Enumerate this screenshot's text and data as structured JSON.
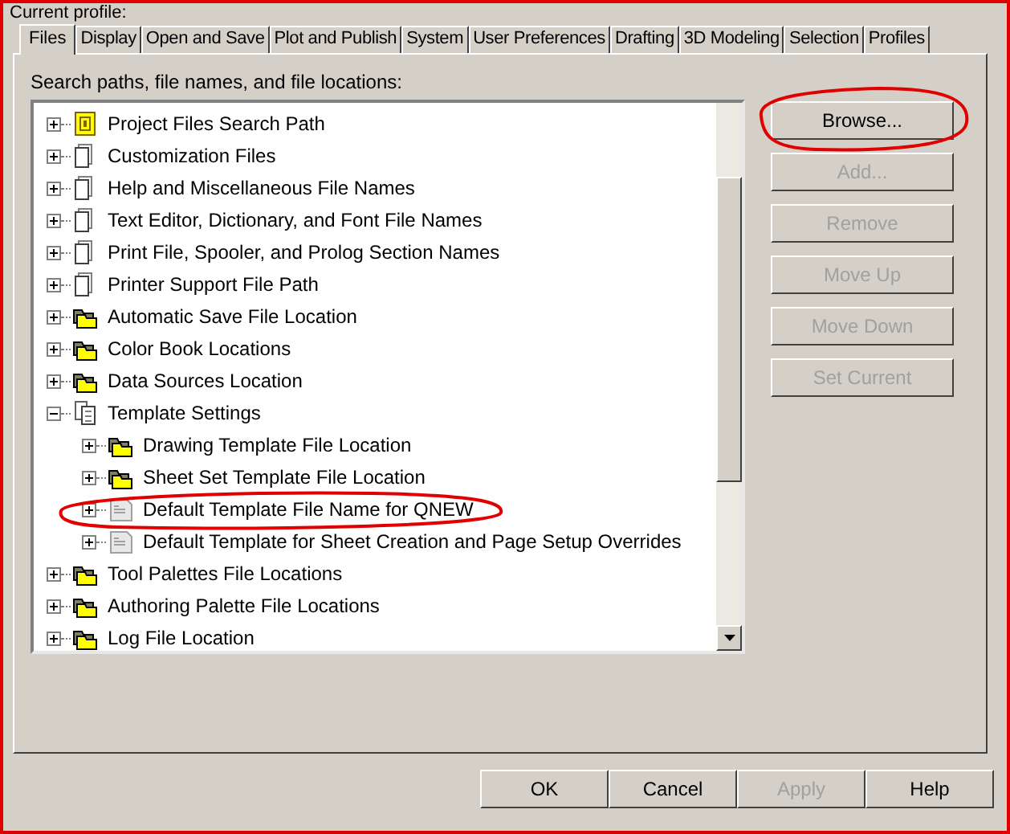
{
  "header": {
    "label": "Current profile:"
  },
  "tabs": [
    {
      "label": "Files",
      "selected": true
    },
    {
      "label": "Display",
      "selected": false
    },
    {
      "label": "Open and Save",
      "selected": false
    },
    {
      "label": "Plot and Publish",
      "selected": false
    },
    {
      "label": "System",
      "selected": false
    },
    {
      "label": "User Preferences",
      "selected": false
    },
    {
      "label": "Drafting",
      "selected": false
    },
    {
      "label": "3D Modeling",
      "selected": false
    },
    {
      "label": "Selection",
      "selected": false
    },
    {
      "label": "Profiles",
      "selected": false
    }
  ],
  "tree": {
    "caption": "Search paths, file names, and file locations:",
    "items": [
      {
        "label": "Project Files Search Path",
        "kind": "project",
        "expanded": false
      },
      {
        "label": "Customization Files",
        "kind": "file",
        "expanded": false
      },
      {
        "label": "Help and Miscellaneous File Names",
        "kind": "file",
        "expanded": false
      },
      {
        "label": "Text Editor, Dictionary, and Font File Names",
        "kind": "file",
        "expanded": false
      },
      {
        "label": "Print File, Spooler, and Prolog Section Names",
        "kind": "file",
        "expanded": false
      },
      {
        "label": "Printer Support File Path",
        "kind": "file",
        "expanded": false
      },
      {
        "label": "Automatic Save File Location",
        "kind": "folder",
        "expanded": false
      },
      {
        "label": "Color Book Locations",
        "kind": "folder",
        "expanded": false
      },
      {
        "label": "Data Sources Location",
        "kind": "folder",
        "expanded": false
      },
      {
        "label": "Template Settings",
        "kind": "pages",
        "expanded": true,
        "children": [
          {
            "label": "Drawing Template File Location",
            "kind": "folder",
            "expanded": false
          },
          {
            "label": "Sheet Set Template File Location",
            "kind": "folder",
            "expanded": false
          },
          {
            "label": "Default Template File Name for QNEW",
            "kind": "dwt",
            "expanded": false
          },
          {
            "label": "Default Template for Sheet Creation and Page Setup Overrides",
            "kind": "dwt",
            "expanded": false
          }
        ]
      },
      {
        "label": "Tool Palettes File Locations",
        "kind": "folder",
        "expanded": false
      },
      {
        "label": "Authoring Palette File Locations",
        "kind": "folder",
        "expanded": false
      },
      {
        "label": "Log File Location",
        "kind": "folder",
        "expanded": false
      }
    ]
  },
  "side_buttons": [
    {
      "label": "Browse...",
      "disabled": false
    },
    {
      "label": "Add...",
      "disabled": true
    },
    {
      "label": "Remove",
      "disabled": true
    },
    {
      "label": "Move Up",
      "disabled": true
    },
    {
      "label": "Move Down",
      "disabled": true
    },
    {
      "label": "Set Current",
      "disabled": true
    }
  ],
  "footer_buttons": [
    {
      "label": "OK",
      "disabled": false
    },
    {
      "label": "Cancel",
      "disabled": false
    },
    {
      "label": "Apply",
      "disabled": true
    },
    {
      "label": "Help",
      "disabled": false
    }
  ]
}
